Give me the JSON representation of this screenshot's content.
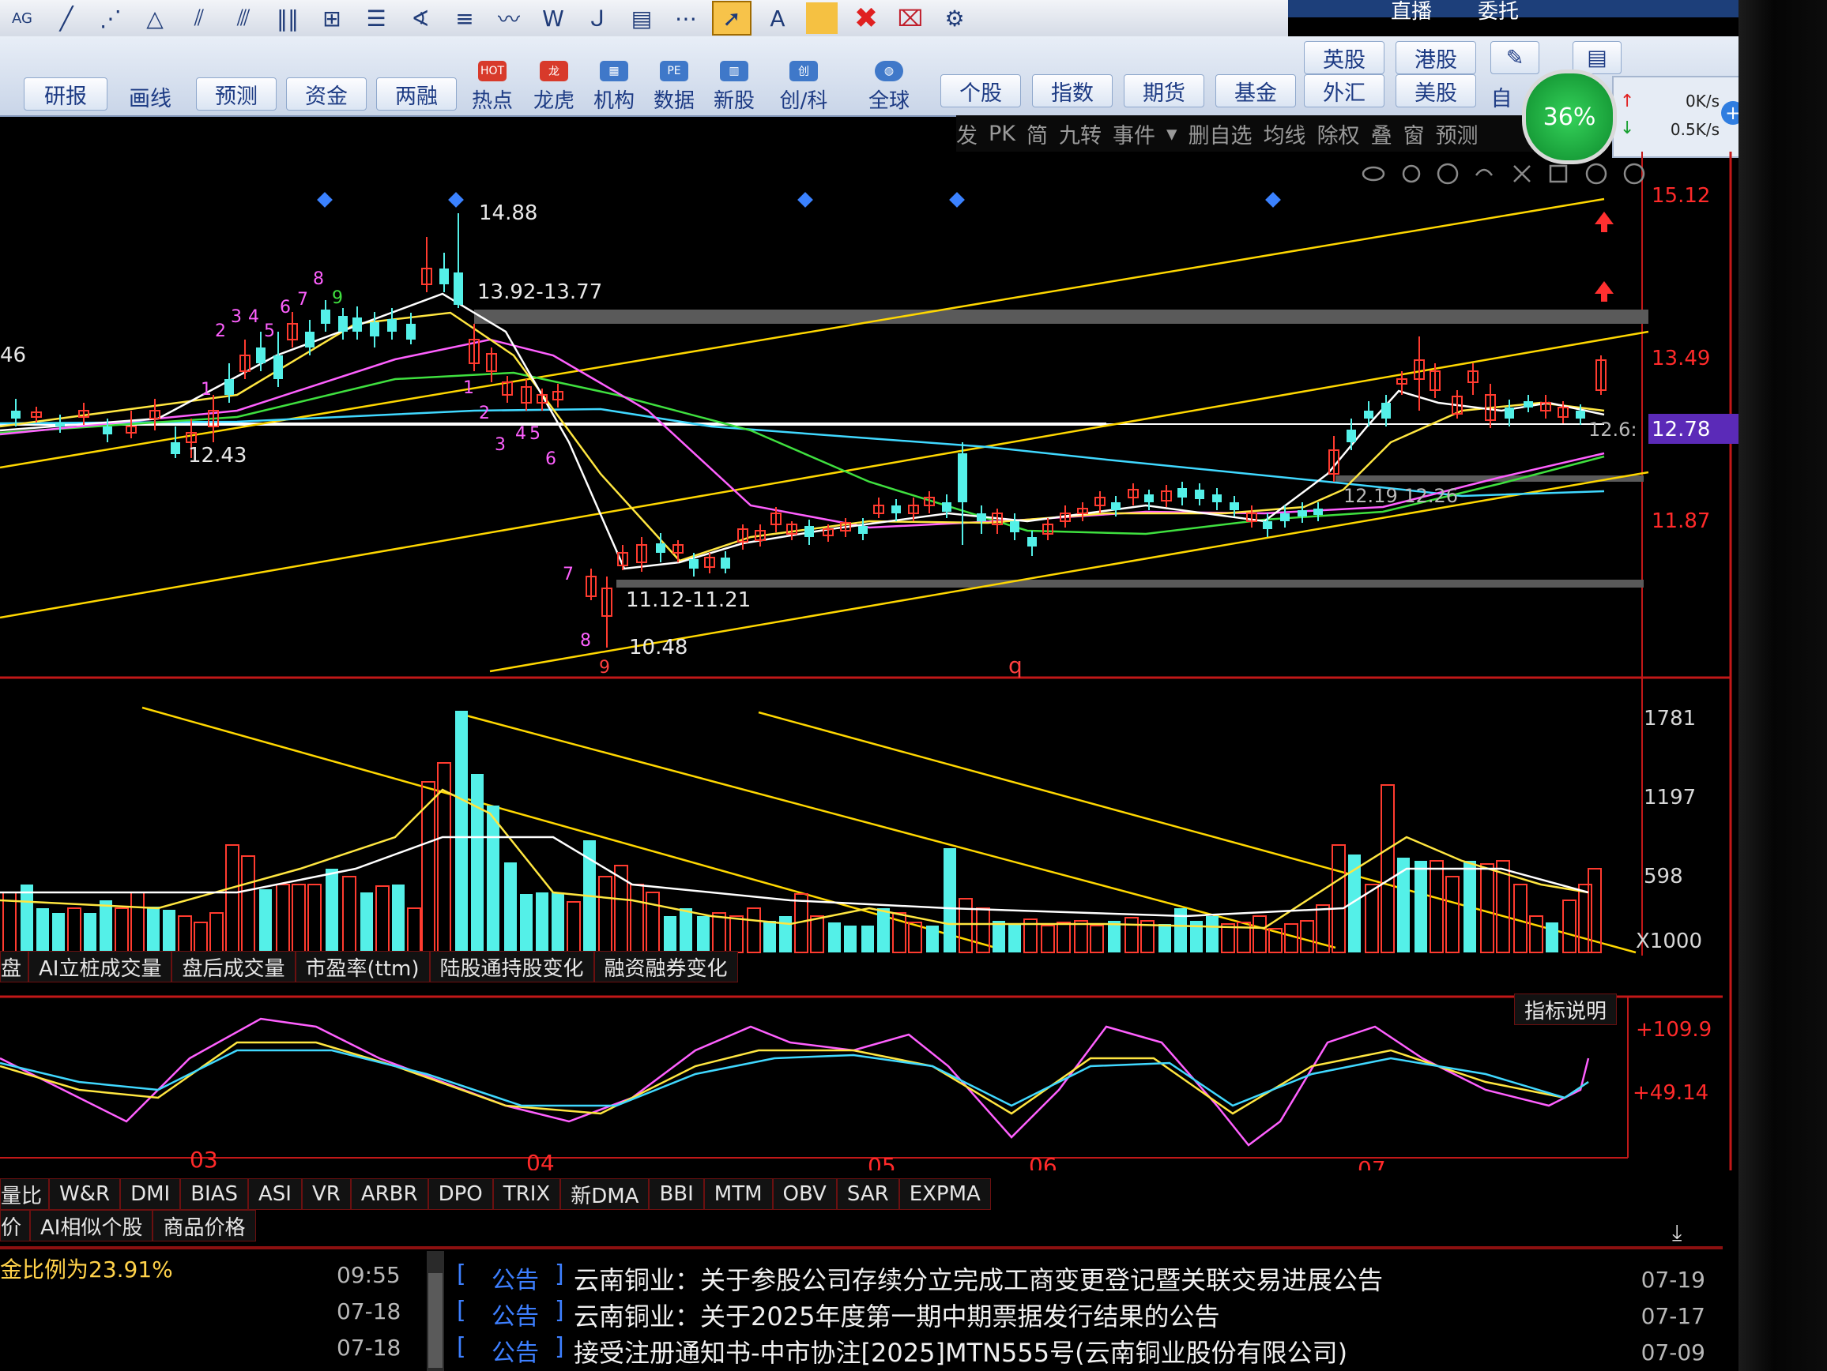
{
  "toolbar": {
    "tools": [
      "AG",
      "slash-line-icon",
      "dot-line-icon",
      "triangle-icon",
      "parallel-lines-icon",
      "hash-lines-icon",
      "vertical-bars-icon",
      "gann-box-icon",
      "fib-icon",
      "fan-icon",
      "horizontal-lines-icon",
      "wave-icon",
      "W",
      "arc-icon",
      "channel-icon",
      "dots-icon",
      "pointer-icon",
      "A",
      "color-swatch",
      "delete-x-icon",
      "delete-mark-icon",
      "gear-icon"
    ],
    "topright": [
      "直播",
      "委托"
    ]
  },
  "nav": {
    "row1_buttons": [
      "英股",
      "港股"
    ],
    "row2_buttons": [
      "研报",
      "画线",
      "预测",
      "资金",
      "两融",
      "热点",
      "龙虎",
      "机构",
      "数据",
      "新股",
      "创/科",
      "全球",
      "个股",
      "指数",
      "期货",
      "基金",
      "外汇",
      "美股",
      "自"
    ],
    "cpu": "36%",
    "net_up": "0K/s",
    "net_down": "0.5K/s"
  },
  "options": [
    "发",
    "PK",
    "简",
    "九转",
    "事件",
    "删自选",
    "均线",
    "除权",
    "叠",
    "窗",
    "预测"
  ],
  "price_axis": {
    "top": "15.12",
    "p1": "13.49",
    "current": "12.78",
    "p3": "11.87"
  },
  "price_annotations": {
    "high": "14.88",
    "zone_top": "13.92-13.77",
    "left_low": "12.43",
    "zone_bottom": "11.12-11.21",
    "low": "10.48",
    "right_mid": "12.19  12.26",
    "left_edge": "46",
    "right_cut": "12.6:",
    "q_mark": "q"
  },
  "volume_axis": {
    "v1": "1781",
    "v2": "1197",
    "v3": "598",
    "unit": "X1000"
  },
  "indicator_tabs": [
    "盘",
    "AI立桩成交量",
    "盘后成交量",
    "市盈率(ttm)",
    "陆股通持股变化",
    "融资融券变化"
  ],
  "indicator_help": "指标说明",
  "osc_axis": {
    "top": "+109.9",
    "mid": "+49.14"
  },
  "months": [
    "03",
    "04",
    "05",
    "06",
    "07"
  ],
  "indicator_list": [
    "量比",
    "W&R",
    "DMI",
    "BIAS",
    "ASI",
    "VR",
    "ARBR",
    "DPO",
    "TRIX",
    "新DMA",
    "BBI",
    "MTM",
    "OBV",
    "SAR",
    "EXPMA"
  ],
  "sub_tabs": [
    "价",
    "AI相似个股",
    "商品价格"
  ],
  "left_panel": {
    "text": "金比例为23.91%",
    "times": [
      "09:55",
      "07-18",
      "07-18"
    ]
  },
  "news": [
    {
      "tag": "公告",
      "title": "云南铜业：关于参股公司存续分立完成工商变更登记暨关联交易进展公告",
      "date": "07-19"
    },
    {
      "tag": "公告",
      "title": "云南铜业：关于2025年度第一期中期票据发行结果的公告",
      "date": "07-17"
    },
    {
      "tag": "公告",
      "title": "接受注册通知书-中市协注[2025]MTN555号(云南铜业股份有限公司)",
      "date": "07-09"
    }
  ],
  "colors": {
    "up": "#ff3b2f",
    "down": "#54f0e8",
    "ma_white": "#ffffff",
    "ma_yellow": "#ffe640",
    "ma_magenta": "#ff60ff",
    "ma_green": "#3fe03f",
    "ma_cyan": "#40d8ff",
    "axis_red": "#ff2a2a"
  }
}
